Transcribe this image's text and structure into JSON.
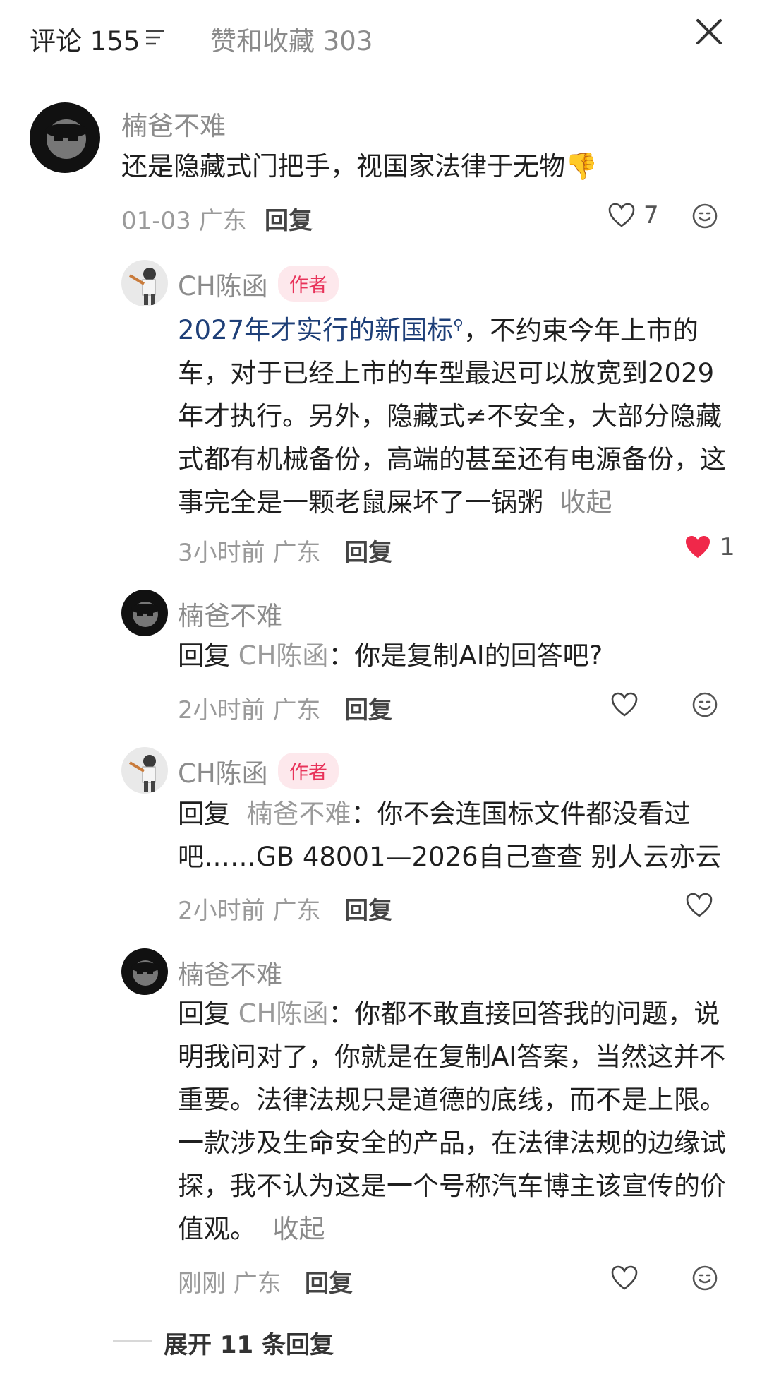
{
  "header": {
    "comments_label": "评论 155",
    "likes_label": "赞和收藏 303"
  },
  "comments": [
    {
      "user": "楠爸不难",
      "text": "还是隐藏式门把手，视国家法律于无物",
      "emoji": "👎",
      "time_loc": "01-03 广东",
      "reply_label": "回复",
      "likes": "7"
    },
    {
      "user": "CH陈函",
      "badge": "作者",
      "link_text": "2027年才实行的新国标",
      "text_rest": "，不约束今年上市的车，对于已经上市的车型最迟可以放宽到2029年才执行。另外，隐藏式≠不安全，大部分隐藏式都有机械备份，高端的甚至还有电源备份，这事完全是一颗老鼠屎坏了一锅粥",
      "collapse": "收起",
      "time_loc": "3小时前 广东",
      "reply_label": "回复",
      "likes": "1"
    },
    {
      "user": "楠爸不难",
      "prefix": "回复",
      "target": "CH陈函",
      "text": "：你是复制AI的回答吧?",
      "time_loc": "2小时前 广东",
      "reply_label": "回复"
    },
    {
      "user": "CH陈函",
      "badge": "作者",
      "prefix": "回复",
      "target": "楠爸不难",
      "text": "：你不会连国标文件都没看过吧……GB 48001—2026自己查查 别人云亦云",
      "time_loc": "2小时前 广东",
      "reply_label": "回复"
    },
    {
      "user": "楠爸不难",
      "prefix": "回复",
      "target": "CH陈函",
      "text": "：你都不敢直接回答我的问题，说明我问对了，你就是在复制AI答案，当然这并不重要。法律法规只是道德的底线，而不是上限。一款涉及生命安全的产品，在法律法规的边缘试探，我不认为这是一个号称汽车博主该宣传的价值观。",
      "collapse": "收起",
      "time_loc": "刚刚 广东",
      "reply_label": "回复"
    }
  ],
  "expand_label": "展开 11 条回复",
  "colors": {
    "author_badge_bg": "#fde8ec",
    "author_badge_text": "#e8335a",
    "heart_active": "#f0284a",
    "link": "#1e3f78"
  }
}
